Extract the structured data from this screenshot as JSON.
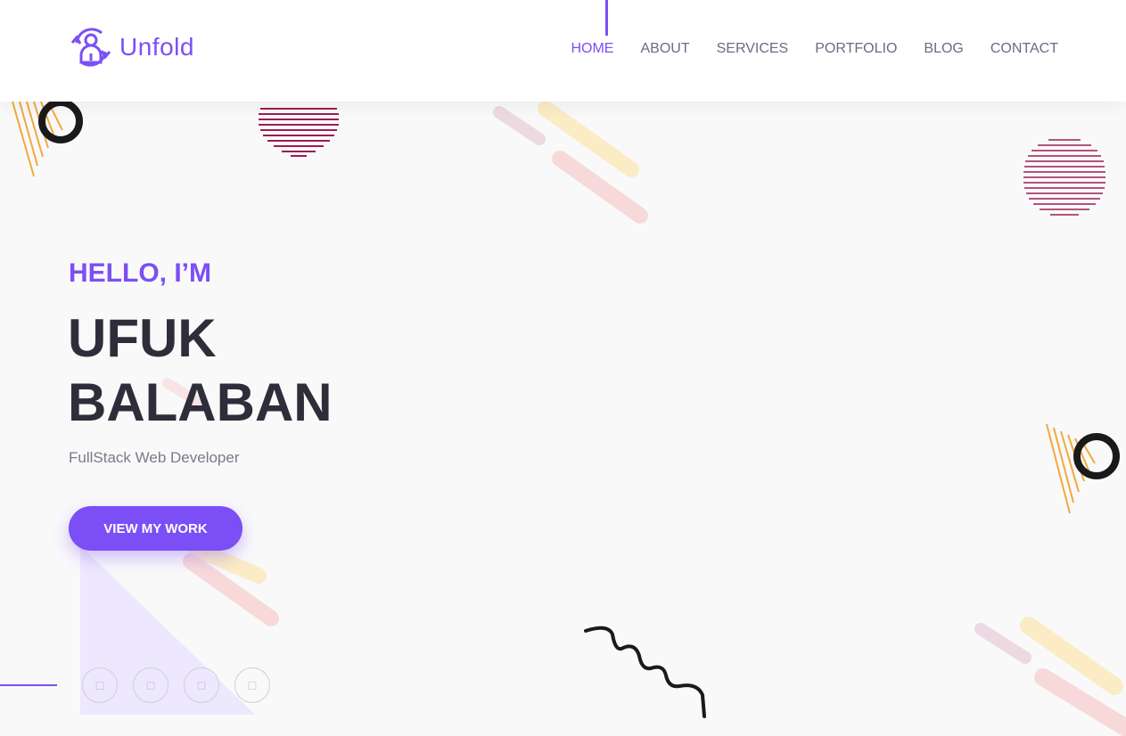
{
  "brand": {
    "name": "Unfold",
    "icon": "person-refresh-icon"
  },
  "nav": {
    "items": [
      {
        "label": "HOME",
        "active": true
      },
      {
        "label": "ABOUT",
        "active": false
      },
      {
        "label": "SERVICES",
        "active": false
      },
      {
        "label": "PORTFOLIO",
        "active": false
      },
      {
        "label": "BLOG",
        "active": false
      },
      {
        "label": "CONTACT",
        "active": false
      }
    ]
  },
  "hero": {
    "greeting": "HELLO, I’M",
    "name_line1": "UFUK",
    "name_line2": "BALABAN",
    "role": "FullStack Web Developer",
    "cta_label": "VIEW MY WORK"
  },
  "social": [
    {
      "icon": "social-icon-1"
    },
    {
      "icon": "social-icon-2"
    },
    {
      "icon": "social-icon-3"
    },
    {
      "icon": "social-icon-4"
    }
  ],
  "colors": {
    "accent": "#7b4ff5",
    "heading": "#2f2d3a",
    "muted": "#7a7a8c",
    "background": "#f9f9fa"
  }
}
